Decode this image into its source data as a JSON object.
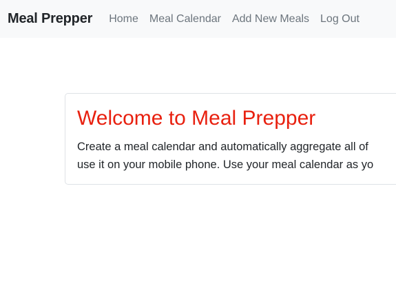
{
  "navbar": {
    "brand": "Meal Prepper",
    "links": [
      {
        "label": "Home"
      },
      {
        "label": "Meal Calendar"
      },
      {
        "label": "Add New Meals"
      },
      {
        "label": "Log Out"
      }
    ]
  },
  "card": {
    "title": "Welcome to Meal Prepper",
    "text_line1": "Create a meal calendar and automatically aggregate all of",
    "text_line2": "use it on your mobile phone. Use your meal calendar as yo"
  },
  "colors": {
    "navbar_bg": "#f8f9fa",
    "title_red": "#e8200f",
    "link_gray": "#6c757d"
  }
}
